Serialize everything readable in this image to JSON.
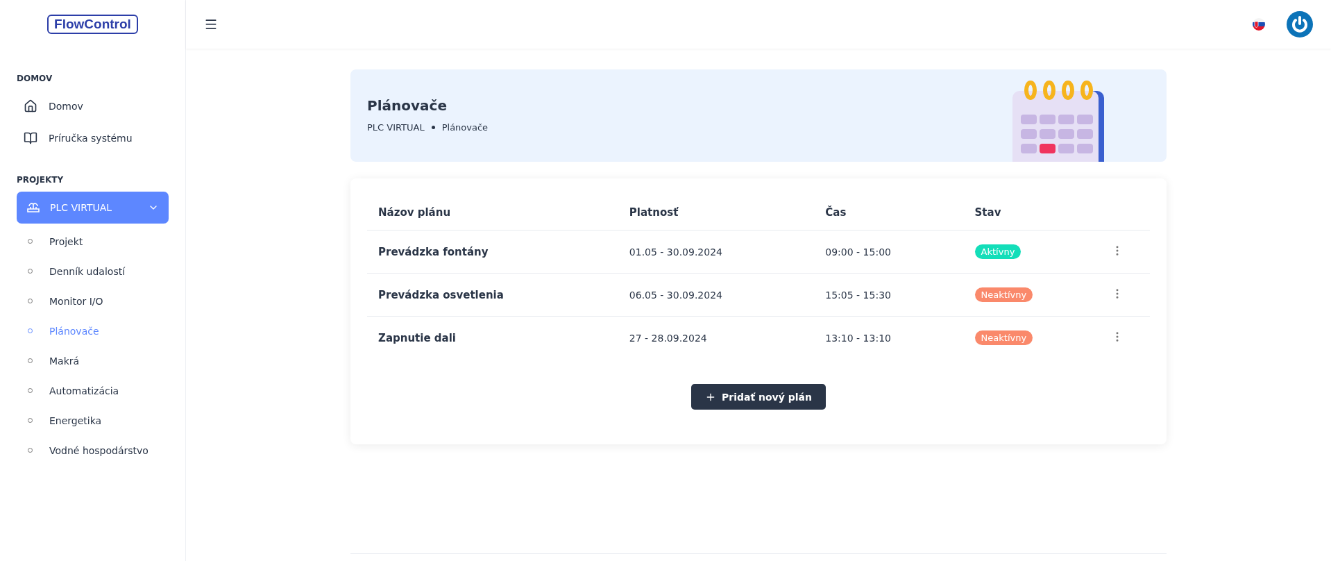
{
  "logo": "FlowControl",
  "sidebar": {
    "sections": [
      {
        "title": "DOMOV",
        "items": [
          {
            "label": "Domov"
          },
          {
            "label": "Príručka systému"
          }
        ]
      },
      {
        "title": "PROJEKTY"
      }
    ],
    "project": {
      "label": "PLC VIRTUAL",
      "expanded": true,
      "children": [
        {
          "label": "Projekt",
          "selected": false
        },
        {
          "label": "Denník udalostí",
          "selected": false
        },
        {
          "label": "Monitor I/O",
          "selected": false
        },
        {
          "label": "Plánovače",
          "selected": true
        },
        {
          "label": "Makrá",
          "selected": false
        },
        {
          "label": "Automatizácia",
          "selected": false
        },
        {
          "label": "Energetika",
          "selected": false
        },
        {
          "label": "Vodné hospodárstvo",
          "selected": false
        }
      ]
    }
  },
  "page": {
    "title": "Plánovače",
    "breadcrumb": [
      "PLC VIRTUAL",
      "Plánovače"
    ]
  },
  "table": {
    "columns": [
      "Názov plánu",
      "Platnosť",
      "Čas",
      "Stav"
    ],
    "rows": [
      {
        "name": "Prevádzka fontány",
        "validity": "01.05 - 30.09.2024",
        "time": "09:00 - 15:00",
        "status": {
          "label": "Aktívny",
          "kind": "active"
        }
      },
      {
        "name": "Prevádzka osvetlenia",
        "validity": "06.05 - 30.09.2024",
        "time": "15:05 - 15:30",
        "status": {
          "label": "Neaktívny",
          "kind": "inactive"
        }
      },
      {
        "name": "Zapnutie dali",
        "validity": "27 - 28.09.2024",
        "time": "13:10 - 13:10",
        "status": {
          "label": "Neaktívny",
          "kind": "inactive"
        }
      }
    ]
  },
  "add_button": {
    "label": "Pridať nový plán"
  }
}
